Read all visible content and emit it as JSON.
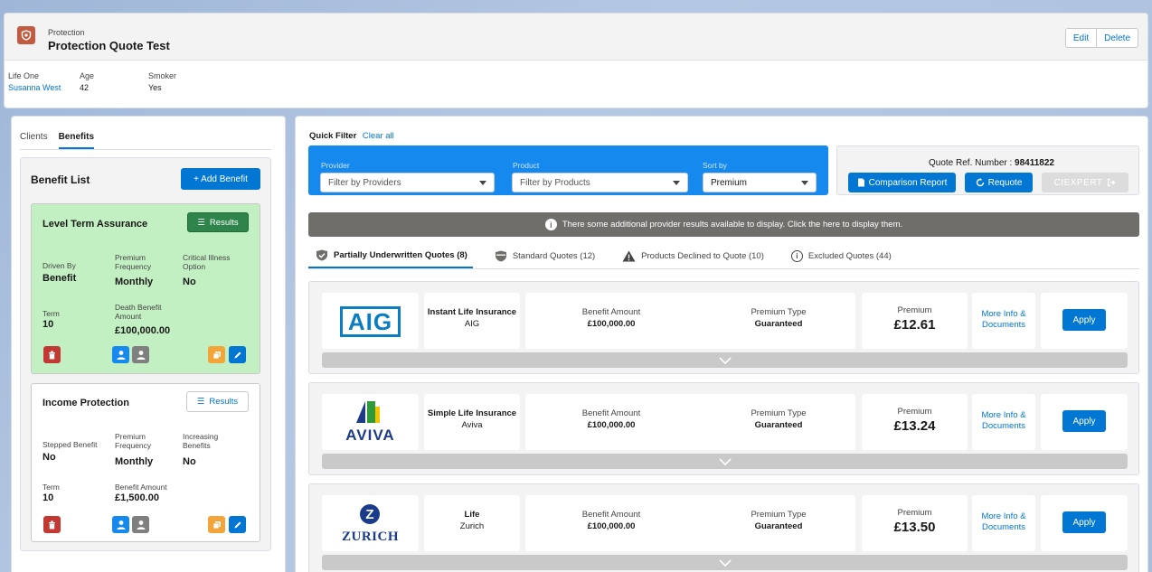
{
  "header": {
    "object_label": "Protection",
    "title": "Protection Quote Test",
    "edit_label": "Edit",
    "delete_label": "Delete",
    "fields": [
      {
        "label": "Life One",
        "value": "Susanna West"
      },
      {
        "label": "Age",
        "value": "42"
      },
      {
        "label": "Smoker",
        "value": "Yes"
      }
    ]
  },
  "left_tabs": {
    "clients": "Clients",
    "benefits": "Benefits"
  },
  "benefit_list": {
    "title": "Benefit List",
    "add_label": "+ Add Benefit",
    "cards": [
      {
        "title": "Level Term Assurance",
        "results_label": "Results",
        "f1_label": "Driven By",
        "f1_value": "Benefit",
        "f2_label": "Premium Frequency",
        "f2_value": "Monthly",
        "f3_label": "Critical Illness Option",
        "f3_value": "No",
        "f4_label": "Term",
        "f4_value": "10",
        "f5_label": "Death Benefit Amount",
        "f5_value": "£100,000.00"
      },
      {
        "title": "Income Protection",
        "results_label": "Results",
        "f1_label": "Stepped Benefit",
        "f1_value": "No",
        "f2_label": "Premium Frequency",
        "f2_value": "Monthly",
        "f3_label": "Increasing Benefits",
        "f3_value": "No",
        "f4_label": "Term",
        "f4_value": "10",
        "f5_label": "Benefit Amount",
        "f5_value": "£1,500.00"
      }
    ]
  },
  "quick_filter": {
    "label": "Quick Filter",
    "clear_label": "Clear all",
    "provider_label": "Provider",
    "provider_placeholder": "Filter by Providers",
    "product_label": "Product",
    "product_placeholder": "Filter by Products",
    "sort_label": "Sort by",
    "sort_value": "Premium"
  },
  "quote_ref": {
    "label": "Quote Ref. Number : ",
    "number": "98411822",
    "comparison_label": "Comparison Report",
    "requote_label": "Requote",
    "ciexpert_label": "CIEXPERT"
  },
  "banner_text": "There some additional provider results available to display. Click the here to display them.",
  "quote_tabs": [
    "Partially Underwritten Quotes (8)",
    "Standard Quotes (12)",
    "Products Declined to Quote (10)",
    "Excluded Quotes (44)"
  ],
  "quotes": [
    {
      "logo": "AIG",
      "product": "Instant Life Insurance",
      "provider": "AIG",
      "benefit_label": "Benefit Amount",
      "benefit": "£100,000.00",
      "type_label": "Premium Type",
      "type": "Guaranteed",
      "premium_label": "Premium",
      "premium": "£12.61",
      "more_info": "More Info & Documents",
      "apply": "Apply"
    },
    {
      "logo": "AVIVA",
      "product": "Simple Life Insurance",
      "provider": "Aviva",
      "benefit_label": "Benefit Amount",
      "benefit": "£100,000.00",
      "type_label": "Premium Type",
      "type": "Guaranteed",
      "premium_label": "Premium",
      "premium": "£13.24",
      "more_info": "More Info & Documents",
      "apply": "Apply"
    },
    {
      "logo": "ZURICH",
      "product": "Life",
      "provider": "Zurich",
      "benefit_label": "Benefit Amount",
      "benefit": "£100,000.00",
      "type_label": "Premium Type",
      "type": "Guaranteed",
      "premium_label": "Premium",
      "premium": "£13.50",
      "more_info": "More Info & Documents",
      "apply": "Apply"
    }
  ],
  "colors": {
    "brand": "#0176d3",
    "filter_bg": "#1589ee",
    "active_card": "#c3f0c2",
    "results_green": "#2e844a",
    "delete_red": "#c23934",
    "copy_orange": "#f4a53a",
    "aig_blue": "#0b7ec1",
    "aviva_blue": "#1e3a8a",
    "zurich_blue": "#1a3a8a"
  },
  "icons": [
    "shield-icon",
    "list-icon",
    "trash-icon",
    "person-icon",
    "copy-icon",
    "pencil-icon",
    "document-icon",
    "refresh-icon",
    "exit-icon",
    "info-icon",
    "chevron-down-icon",
    "check-shield-icon",
    "warning-icon",
    "caret-down-icon"
  ]
}
